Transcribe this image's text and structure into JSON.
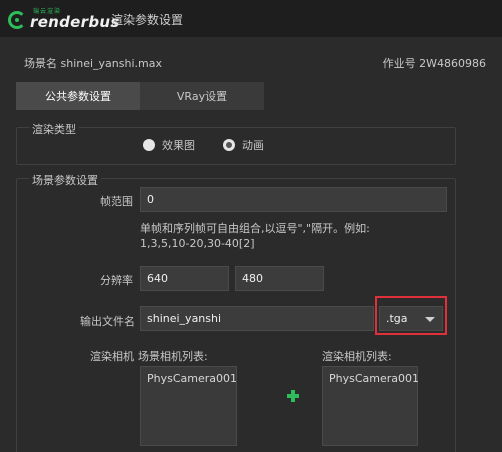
{
  "titlebar": {
    "logo_sub": "瑞云渲染",
    "logo_text": "renderbus",
    "title": "渲染参数设置"
  },
  "header": {
    "scene_name": "场景名 shinei_yanshi.max",
    "job_id": "作业号 2W4860986"
  },
  "tabs": [
    {
      "label": "公共参数设置",
      "active": true
    },
    {
      "label": "VRay设置",
      "active": false
    }
  ],
  "render_type": {
    "title": "渲染类型",
    "options": [
      {
        "label": "效果图",
        "checked": false
      },
      {
        "label": "动画",
        "checked": true
      }
    ]
  },
  "scene_params": {
    "title": "场景参数设置",
    "frame_range_label": "帧范围",
    "frame_range_value": "0",
    "hint_line1": "单帧和序列帧可自由组合,以逗号\",\"隔开。例如:",
    "hint_line2": "1,3,5,10-20,30-40[2]",
    "resolution_label": "分辨率",
    "width": "640",
    "height": "480",
    "output_label": "输出文件名",
    "output_name": "shinei_yanshi",
    "output_ext": ".tga",
    "render_camera_label": "渲染相机",
    "scene_camera_list_label": "场景相机列表:",
    "render_camera_list_label": "渲染相机列表:",
    "scene_cameras": [
      "PhysCamera001"
    ],
    "render_cameras": [
      "PhysCamera001"
    ]
  },
  "colors": {
    "accent": "#2dbd5a",
    "highlight": "#e0303a",
    "background": "#2b2b2b"
  }
}
